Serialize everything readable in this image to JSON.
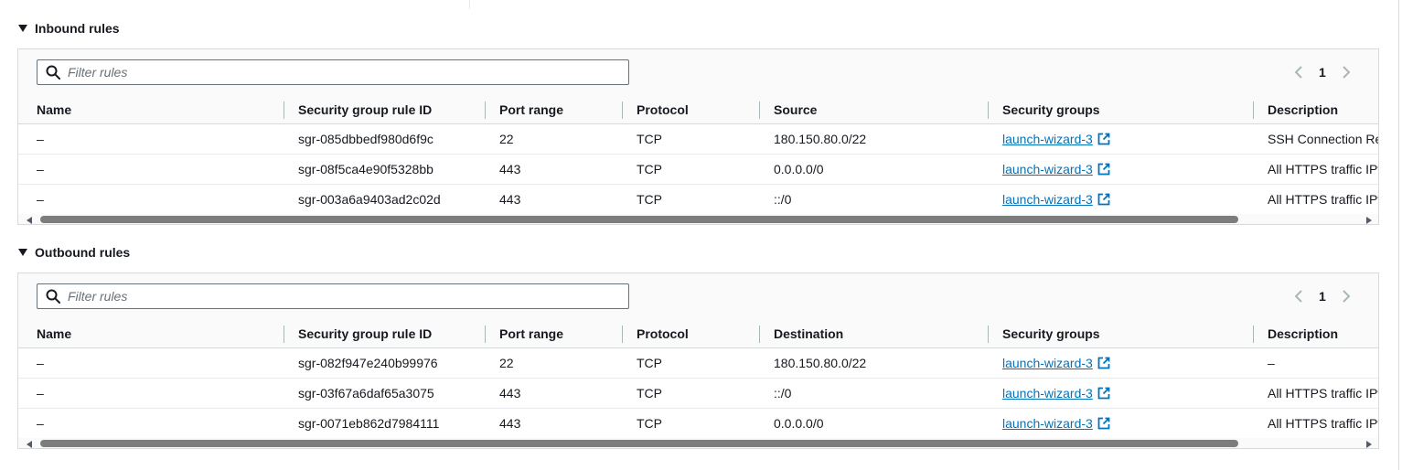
{
  "inbound": {
    "title": "Inbound rules",
    "filter_placeholder": "Filter rules",
    "page": "1",
    "columns": [
      "Name",
      "Security group rule ID",
      "Port range",
      "Protocol",
      "Source",
      "Security groups",
      "Description"
    ],
    "rows": [
      {
        "name": "–",
        "rule_id": "sgr-085dbbedf980d6f9c",
        "port": "22",
        "protocol": "TCP",
        "source": "180.150.80.0/22",
        "sg": "launch-wizard-3",
        "description": "SSH Connection Res"
      },
      {
        "name": "–",
        "rule_id": "sgr-08f5ca4e90f5328bb",
        "port": "443",
        "protocol": "TCP",
        "source": "0.0.0.0/0",
        "sg": "launch-wizard-3",
        "description": "All HTTPS traffic IPv"
      },
      {
        "name": "–",
        "rule_id": "sgr-003a6a9403ad2c02d",
        "port": "443",
        "protocol": "TCP",
        "source": "::/0",
        "sg": "launch-wizard-3",
        "description": "All HTTPS traffic IPv"
      }
    ]
  },
  "outbound": {
    "title": "Outbound rules",
    "filter_placeholder": "Filter rules",
    "page": "1",
    "columns": [
      "Name",
      "Security group rule ID",
      "Port range",
      "Protocol",
      "Destination",
      "Security groups",
      "Description"
    ],
    "rows": [
      {
        "name": "–",
        "rule_id": "sgr-082f947e240b99976",
        "port": "22",
        "protocol": "TCP",
        "source": "180.150.80.0/22",
        "sg": "launch-wizard-3",
        "description": "–"
      },
      {
        "name": "–",
        "rule_id": "sgr-03f67a6daf65a3075",
        "port": "443",
        "protocol": "TCP",
        "source": "::/0",
        "sg": "launch-wizard-3",
        "description": "All HTTPS traffic IPv"
      },
      {
        "name": "–",
        "rule_id": "sgr-0071eb862d7984111",
        "port": "443",
        "protocol": "TCP",
        "source": "0.0.0.0/0",
        "sg": "launch-wizard-3",
        "description": "All HTTPS traffic IPv"
      }
    ]
  },
  "icons": {
    "caret": "caret-down-icon",
    "search": "search-icon",
    "prev": "chevron-left-icon",
    "next": "chevron-right-icon",
    "external": "external-link-icon"
  },
  "colors": {
    "link": "#0073bb",
    "border": "#d5dbdb",
    "panel_bg": "#fafafa",
    "text": "#16191f",
    "muted": "#687078"
  }
}
